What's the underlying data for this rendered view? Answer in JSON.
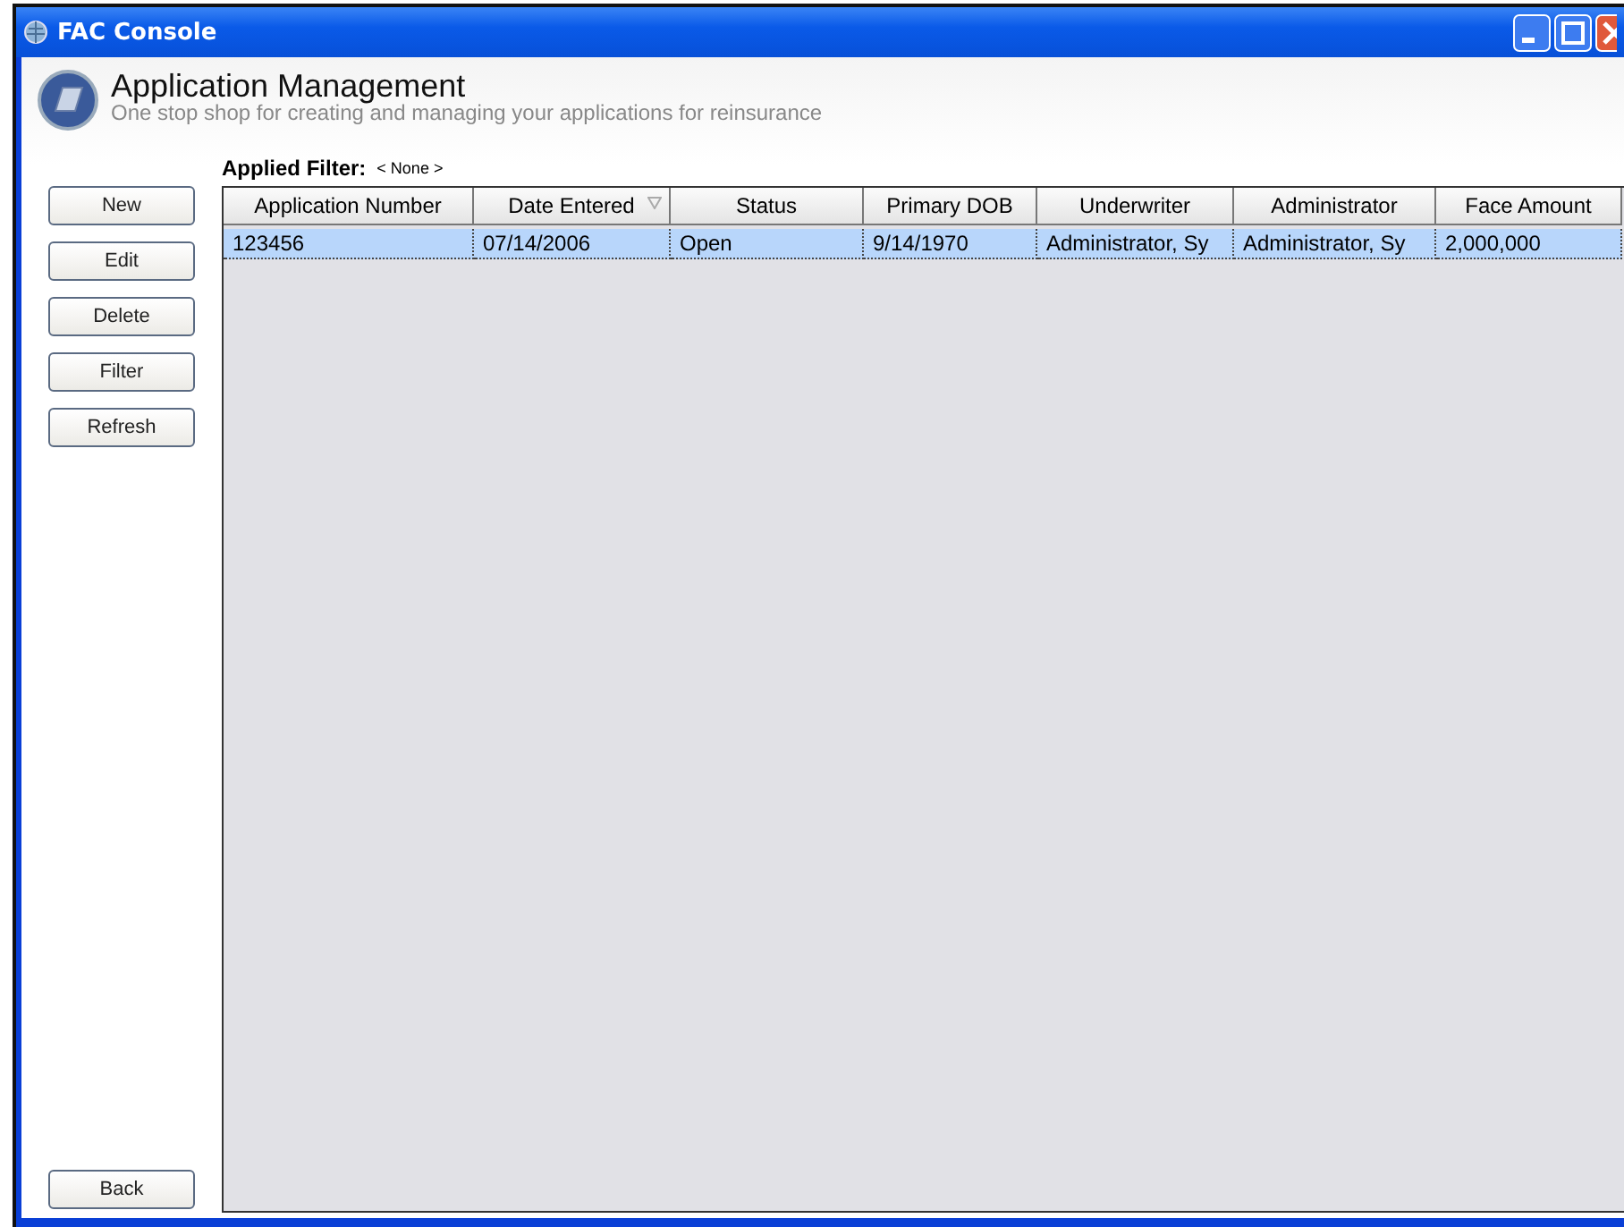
{
  "window": {
    "title": "FAC Console"
  },
  "header": {
    "title": "Application Management",
    "subtitle": "One stop shop for creating and managing your applications for reinsurance"
  },
  "filter": {
    "label": "Applied Filter:",
    "value": "< None >"
  },
  "actions": [
    "New",
    "Edit",
    "Delete",
    "Filter",
    "Refresh"
  ],
  "back_button": "Back",
  "table": {
    "columns": [
      {
        "label": "Application Number",
        "sorted": false
      },
      {
        "label": "Date Entered",
        "sorted": true
      },
      {
        "label": "Status",
        "sorted": false
      },
      {
        "label": "Primary DOB",
        "sorted": false
      },
      {
        "label": "Underwriter",
        "sorted": false
      },
      {
        "label": "Administrator",
        "sorted": false
      },
      {
        "label": "Face Amount",
        "sorted": false
      }
    ],
    "rows": [
      {
        "selected": true,
        "cells": [
          "123456",
          "07/14/2006",
          "Open",
          "9/14/1970",
          "Administrator, Sy",
          "Administrator, Sy",
          "2,000,000"
        ]
      }
    ]
  }
}
